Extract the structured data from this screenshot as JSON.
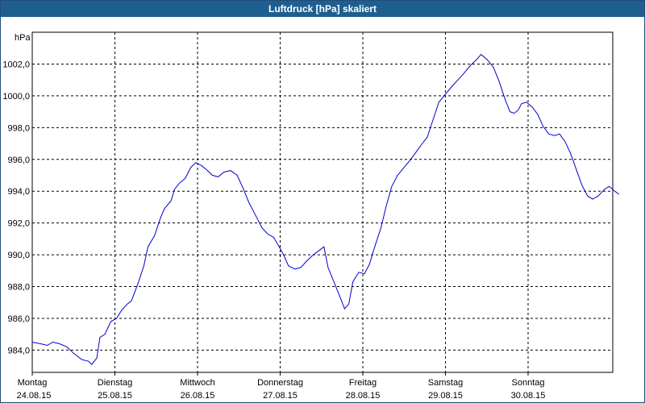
{
  "window": {
    "title": "Luftdruck [hPa] skaliert"
  },
  "colors": {
    "titlebar": "#1f5f8f",
    "line": "#0000cc",
    "grid": "#000000"
  },
  "chart_data": {
    "type": "line",
    "title": "Luftdruck [hPa] skaliert",
    "ylabel": "hPa",
    "ylim": [
      982.6,
      1004.0
    ],
    "xlim": [
      0,
      7.16
    ],
    "grid": true,
    "yticks": [
      "984,0",
      "986,0",
      "988,0",
      "990,0",
      "992,0",
      "994,0",
      "996,0",
      "998,0",
      "1000,0",
      "1002,0"
    ],
    "ytick_values": [
      984,
      986,
      988,
      990,
      992,
      994,
      996,
      998,
      1000,
      1002
    ],
    "xticks": [
      {
        "day": "Montag",
        "date": "24.08.15"
      },
      {
        "day": "Dienstag",
        "date": "25.08.15"
      },
      {
        "day": "Mittwoch",
        "date": "26.08.15"
      },
      {
        "day": "Donnerstag",
        "date": "27.08.15"
      },
      {
        "day": "Freitag",
        "date": "28.08.15"
      },
      {
        "day": "Samstag",
        "date": "29.08.15"
      },
      {
        "day": "Sonntag",
        "date": "30.08.15"
      }
    ],
    "x_unit": "days since Montag 24.08.15 00:00",
    "series": [
      {
        "points": [
          [
            0.0,
            984.5
          ],
          [
            0.1,
            984.4
          ],
          [
            0.18,
            984.3
          ],
          [
            0.25,
            984.5
          ],
          [
            0.33,
            984.4
          ],
          [
            0.42,
            984.2
          ],
          [
            0.5,
            983.8
          ],
          [
            0.6,
            983.4
          ],
          [
            0.68,
            983.3
          ],
          [
            0.72,
            983.1
          ],
          [
            0.78,
            983.5
          ],
          [
            0.82,
            984.8
          ],
          [
            0.88,
            985.0
          ],
          [
            0.95,
            985.8
          ],
          [
            1.02,
            986.0
          ],
          [
            1.08,
            986.5
          ],
          [
            1.15,
            986.9
          ],
          [
            1.2,
            987.1
          ],
          [
            1.28,
            988.2
          ],
          [
            1.35,
            989.3
          ],
          [
            1.4,
            990.5
          ],
          [
            1.48,
            991.2
          ],
          [
            1.55,
            992.3
          ],
          [
            1.6,
            992.9
          ],
          [
            1.68,
            993.4
          ],
          [
            1.72,
            994.1
          ],
          [
            1.78,
            994.5
          ],
          [
            1.85,
            994.8
          ],
          [
            1.92,
            995.5
          ],
          [
            1.98,
            995.8
          ],
          [
            2.05,
            995.6
          ],
          [
            2.12,
            995.3
          ],
          [
            2.18,
            995.0
          ],
          [
            2.25,
            994.9
          ],
          [
            2.32,
            995.2
          ],
          [
            2.4,
            995.3
          ],
          [
            2.48,
            995.0
          ],
          [
            2.55,
            994.2
          ],
          [
            2.62,
            993.3
          ],
          [
            2.7,
            992.5
          ],
          [
            2.78,
            991.7
          ],
          [
            2.85,
            991.3
          ],
          [
            2.92,
            991.1
          ],
          [
            3.0,
            990.4
          ],
          [
            3.05,
            989.9
          ],
          [
            3.1,
            989.3
          ],
          [
            3.18,
            989.1
          ],
          [
            3.25,
            989.2
          ],
          [
            3.32,
            989.6
          ],
          [
            3.4,
            990.0
          ],
          [
            3.48,
            990.3
          ],
          [
            3.53,
            990.5
          ],
          [
            3.58,
            989.2
          ],
          [
            3.65,
            988.3
          ],
          [
            3.72,
            987.4
          ],
          [
            3.78,
            986.6
          ],
          [
            3.83,
            986.9
          ],
          [
            3.88,
            988.3
          ],
          [
            3.95,
            988.9
          ],
          [
            4.02,
            988.8
          ],
          [
            4.08,
            989.4
          ],
          [
            4.15,
            990.6
          ],
          [
            4.22,
            991.7
          ],
          [
            4.28,
            993.0
          ],
          [
            4.35,
            994.3
          ],
          [
            4.42,
            995.0
          ],
          [
            4.5,
            995.5
          ],
          [
            4.58,
            996.0
          ],
          [
            4.65,
            996.5
          ],
          [
            4.72,
            997.0
          ],
          [
            4.78,
            997.4
          ],
          [
            4.85,
            998.5
          ],
          [
            4.92,
            999.6
          ],
          [
            5.0,
            1000.1
          ],
          [
            5.08,
            1000.6
          ],
          [
            5.15,
            1001.0
          ],
          [
            5.22,
            1001.4
          ],
          [
            5.3,
            1001.9
          ],
          [
            5.38,
            1002.3
          ],
          [
            5.43,
            1002.6
          ],
          [
            5.5,
            1002.3
          ],
          [
            5.58,
            1001.8
          ],
          [
            5.65,
            1000.9
          ],
          [
            5.72,
            999.8
          ],
          [
            5.78,
            999.0
          ],
          [
            5.83,
            998.9
          ],
          [
            5.88,
            999.1
          ],
          [
            5.92,
            999.5
          ],
          [
            5.98,
            999.6
          ],
          [
            6.05,
            999.3
          ],
          [
            6.12,
            998.8
          ],
          [
            6.18,
            998.1
          ],
          [
            6.25,
            997.6
          ],
          [
            6.32,
            997.5
          ],
          [
            6.38,
            997.6
          ],
          [
            6.45,
            997.1
          ],
          [
            6.52,
            996.3
          ],
          [
            6.58,
            995.4
          ],
          [
            6.65,
            994.4
          ],
          [
            6.72,
            993.7
          ],
          [
            6.78,
            993.5
          ],
          [
            6.85,
            993.7
          ],
          [
            6.92,
            994.1
          ],
          [
            6.98,
            994.3
          ],
          [
            7.05,
            994.0
          ],
          [
            7.1,
            993.8
          ]
        ]
      }
    ]
  }
}
